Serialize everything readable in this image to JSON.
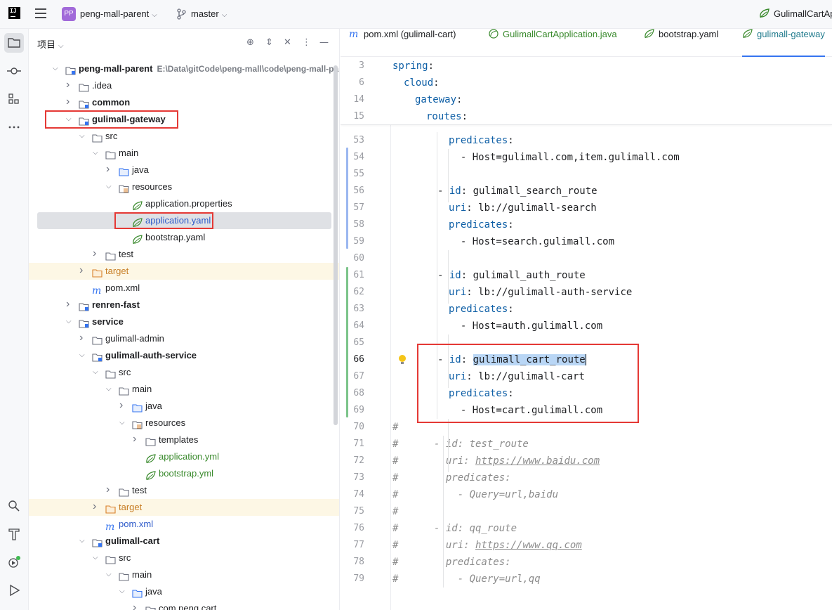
{
  "topbar": {
    "logo_text": "IJ",
    "project_initials": "PP",
    "project_name": "peng-mall-parent",
    "branch": "master",
    "run_config": "GulimallCartAp"
  },
  "project_panel": {
    "title": "项目",
    "tree": [
      {
        "label": "peng-mall-parent",
        "path": "E:\\Data\\gitCode\\peng-mall\\code\\peng-mall-par",
        "bold": true,
        "indent": 0,
        "arrow": "down",
        "icon": "module"
      },
      {
        "label": ".idea",
        "indent": 1,
        "arrow": "right",
        "icon": "folder"
      },
      {
        "label": "common",
        "bold": true,
        "indent": 1,
        "arrow": "right",
        "icon": "module"
      },
      {
        "label": "gulimall-gateway",
        "bold": true,
        "indent": 1,
        "arrow": "down",
        "icon": "module"
      },
      {
        "label": "src",
        "indent": 2,
        "arrow": "down",
        "icon": "folder"
      },
      {
        "label": "main",
        "indent": 3,
        "arrow": "down",
        "icon": "folder"
      },
      {
        "label": "java",
        "indent": 4,
        "arrow": "right",
        "icon": "folder-blue"
      },
      {
        "label": "resources",
        "indent": 4,
        "arrow": "down",
        "icon": "folder-res"
      },
      {
        "label": "application.properties",
        "indent": 5,
        "icon": "leaf"
      },
      {
        "label": "application.yaml",
        "indent": 5,
        "icon": "leaf",
        "style": "blue",
        "selected": true
      },
      {
        "label": "bootstrap.yaml",
        "indent": 5,
        "icon": "leaf"
      },
      {
        "label": "test",
        "indent": 3,
        "arrow": "right",
        "icon": "folder"
      },
      {
        "label": "target",
        "indent": 2,
        "arrow": "right",
        "icon": "folder-orange",
        "style": "orange",
        "yellow": true
      },
      {
        "label": "pom.xml",
        "indent": 2,
        "icon": "maven"
      },
      {
        "label": "renren-fast",
        "bold": true,
        "indent": 1,
        "arrow": "right",
        "icon": "module"
      },
      {
        "label": "service",
        "bold": true,
        "indent": 1,
        "arrow": "down",
        "icon": "module"
      },
      {
        "label": "gulimall-admin",
        "indent": 2,
        "arrow": "right",
        "icon": "folder"
      },
      {
        "label": "gulimall-auth-service",
        "bold": true,
        "indent": 2,
        "arrow": "down",
        "icon": "module"
      },
      {
        "label": "src",
        "indent": 3,
        "arrow": "down",
        "icon": "folder"
      },
      {
        "label": "main",
        "indent": 4,
        "arrow": "down",
        "icon": "folder"
      },
      {
        "label": "java",
        "indent": 5,
        "arrow": "right",
        "icon": "folder-blue"
      },
      {
        "label": "resources",
        "indent": 5,
        "arrow": "down",
        "icon": "folder-res"
      },
      {
        "label": "templates",
        "indent": 6,
        "arrow": "right",
        "icon": "folder"
      },
      {
        "label": "application.yml",
        "indent": 6,
        "icon": "leaf",
        "style": "green"
      },
      {
        "label": "bootstrap.yml",
        "indent": 6,
        "icon": "leaf",
        "style": "green"
      },
      {
        "label": "test",
        "indent": 4,
        "arrow": "right",
        "icon": "folder"
      },
      {
        "label": "target",
        "indent": 3,
        "arrow": "right",
        "icon": "folder-orange",
        "style": "orange",
        "yellow": true
      },
      {
        "label": "pom.xml",
        "indent": 3,
        "icon": "maven",
        "style": "blue"
      },
      {
        "label": "gulimall-cart",
        "bold": true,
        "indent": 2,
        "arrow": "down",
        "icon": "module"
      },
      {
        "label": "src",
        "indent": 3,
        "arrow": "down",
        "icon": "folder"
      },
      {
        "label": "main",
        "indent": 4,
        "arrow": "down",
        "icon": "folder"
      },
      {
        "label": "java",
        "indent": 5,
        "arrow": "down",
        "icon": "folder-blue"
      },
      {
        "label": "com.peng.cart",
        "indent": 6,
        "arrow": "right",
        "icon": "folder"
      }
    ]
  },
  "tabs": [
    {
      "label": "pom.xml (gulimall-cart)",
      "icon": "maven"
    },
    {
      "label": "GulimallCartApplication.java",
      "icon": "spring-class",
      "style": "green"
    },
    {
      "label": "bootstrap.yaml",
      "icon": "leaf"
    },
    {
      "label": "gulimall-gateway",
      "icon": "leaf",
      "active": true,
      "style": "cyan"
    }
  ],
  "editor": {
    "sticky": [
      {
        "ln": "3",
        "parts": [
          [
            "k",
            "spring"
          ],
          [
            "v",
            ":"
          ]
        ],
        "indent": 0
      },
      {
        "ln": "6",
        "parts": [
          [
            "k",
            "cloud"
          ],
          [
            "v",
            ":"
          ]
        ],
        "indent": 1
      },
      {
        "ln": "14",
        "parts": [
          [
            "k",
            "gateway"
          ],
          [
            "v",
            ":"
          ]
        ],
        "indent": 2
      },
      {
        "ln": "15",
        "parts": [
          [
            "k",
            "routes"
          ],
          [
            "v",
            ":"
          ]
        ],
        "indent": 3
      }
    ],
    "lines": [
      {
        "ln": "53",
        "parts": [
          [
            "k",
            "predicates"
          ],
          [
            "v",
            ":"
          ]
        ],
        "indent": 5
      },
      {
        "ln": "54",
        "parts": [
          [
            "v",
            "  - Host=gulimall.com,item.gulimall.com"
          ]
        ],
        "indent": 5
      },
      {
        "ln": "55",
        "parts": []
      },
      {
        "ln": "56",
        "parts": [
          [
            "v",
            "- "
          ],
          [
            "k",
            "id"
          ],
          [
            "v",
            ": gulimall_search_route"
          ]
        ],
        "indent": 4
      },
      {
        "ln": "57",
        "parts": [
          [
            "k",
            "uri"
          ],
          [
            "v",
            ": lb://gulimall-search"
          ]
        ],
        "indent": 5
      },
      {
        "ln": "58",
        "parts": [
          [
            "k",
            "predicates"
          ],
          [
            "v",
            ":"
          ]
        ],
        "indent": 5
      },
      {
        "ln": "59",
        "parts": [
          [
            "v",
            "  - Host=search.gulimall.com"
          ]
        ],
        "indent": 5
      },
      {
        "ln": "60",
        "parts": []
      },
      {
        "ln": "61",
        "parts": [
          [
            "v",
            "- "
          ],
          [
            "k",
            "id"
          ],
          [
            "v",
            ": gulimall_auth_route"
          ]
        ],
        "indent": 4
      },
      {
        "ln": "62",
        "parts": [
          [
            "k",
            "uri"
          ],
          [
            "v",
            ": lb://gulimall-auth-service"
          ]
        ],
        "indent": 5
      },
      {
        "ln": "63",
        "parts": [
          [
            "k",
            "predicates"
          ],
          [
            "v",
            ":"
          ]
        ],
        "indent": 5
      },
      {
        "ln": "64",
        "parts": [
          [
            "v",
            "  - Host=auth.gulimall.com"
          ]
        ],
        "indent": 5
      },
      {
        "ln": "65",
        "parts": []
      },
      {
        "ln": "66",
        "parts": [
          [
            "v",
            "- "
          ],
          [
            "k",
            "id"
          ],
          [
            "v",
            ": "
          ],
          [
            "hl",
            "gulimall_cart_route"
          ]
        ],
        "indent": 4,
        "current": true,
        "bulb": true
      },
      {
        "ln": "67",
        "parts": [
          [
            "k",
            "uri"
          ],
          [
            "v",
            ": lb://gulimall-cart"
          ]
        ],
        "indent": 5
      },
      {
        "ln": "68",
        "parts": [
          [
            "k",
            "predicates"
          ],
          [
            "v",
            ":"
          ]
        ],
        "indent": 5
      },
      {
        "ln": "69",
        "parts": [
          [
            "v",
            "  - Host=cart.gulimall.com"
          ]
        ],
        "indent": 5
      },
      {
        "ln": "70",
        "parts": [
          [
            "cm",
            "#"
          ]
        ],
        "indent": 0
      },
      {
        "ln": "71",
        "parts": [
          [
            "cm",
            "#      - id: test_route"
          ]
        ],
        "indent": 0
      },
      {
        "ln": "72",
        "parts": [
          [
            "cm",
            "#        uri: "
          ],
          [
            "cmu",
            "https://www.baidu.com"
          ]
        ],
        "indent": 0
      },
      {
        "ln": "73",
        "parts": [
          [
            "cm",
            "#        predicates:"
          ]
        ],
        "indent": 0
      },
      {
        "ln": "74",
        "parts": [
          [
            "cm",
            "#          - Query=url,baidu"
          ]
        ],
        "indent": 0
      },
      {
        "ln": "75",
        "parts": [
          [
            "cm",
            "#"
          ]
        ],
        "indent": 0
      },
      {
        "ln": "76",
        "parts": [
          [
            "cm",
            "#      - id: qq_route"
          ]
        ],
        "indent": 0
      },
      {
        "ln": "77",
        "parts": [
          [
            "cm",
            "#        uri: "
          ],
          [
            "cmu",
            "https://www.qq.com"
          ]
        ],
        "indent": 0
      },
      {
        "ln": "78",
        "parts": [
          [
            "cm",
            "#        predicates:"
          ]
        ],
        "indent": 0
      },
      {
        "ln": "79",
        "parts": [
          [
            "cm",
            "#          - Query=url,qq"
          ]
        ],
        "indent": 0
      }
    ]
  },
  "colors": {
    "keyword": "#0e5fa6",
    "comment": "#8c8c8c",
    "selection": "#b9d6f5",
    "annotation_box": "#e53935",
    "accent": "#3574f0"
  }
}
